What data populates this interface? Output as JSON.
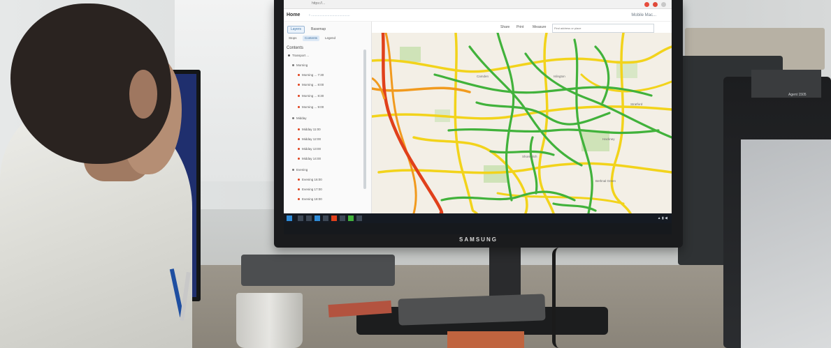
{
  "photo": {
    "monitor_brand": "SAMSUNG",
    "device_label": "Agent 1505"
  },
  "browser": {
    "url": "https://..."
  },
  "app": {
    "home_label": "Home",
    "breadcrumb": "› ........................................",
    "right_label": "Mobile Mac..."
  },
  "panel": {
    "buttons": [
      "Layers",
      "Basemap"
    ],
    "tabs": [
      "Stops",
      "Contents",
      "Legend"
    ],
    "heading": "Contents",
    "items": [
      "Transport ...",
      "Morning",
      "Morning ... 7:30",
      "Morning ... 8:00",
      "Morning ... 8:30",
      "Morning ... 9:00",
      "Midday",
      "Midday 11:00",
      "Midday 12:00",
      "Midday 13:00",
      "Midday 14:00",
      "Evening",
      "Evening 16:00",
      "Evening 17:00",
      "Evening 18:00"
    ]
  },
  "toolbar": {
    "items": [
      "Share",
      "Print",
      "Measure"
    ],
    "search_placeholder": "Find address or place"
  },
  "map_labels": [
    "Hackney",
    "Stratford",
    "Shoreditch",
    "Camden",
    "Islington",
    "Bethnal Green"
  ],
  "colors": {
    "traffic_green": "#41b23b",
    "traffic_yellow": "#f2d31b",
    "traffic_orange": "#f19a1e",
    "traffic_red": "#e0401b",
    "taskbar": "#151a22",
    "accent_blue": "#4679a8"
  }
}
